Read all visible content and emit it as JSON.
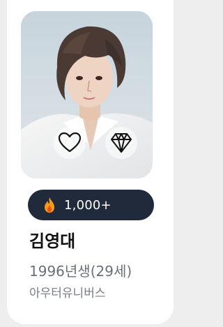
{
  "profile": {
    "name": "김영대",
    "birth": "1996년생(29세)",
    "agency": "아우터유니버스"
  },
  "stats": {
    "count_label": "1,000+",
    "icon": "fire-icon"
  },
  "actions": {
    "like_icon": "heart-icon",
    "gem_icon": "diamond-icon"
  },
  "colors": {
    "pill_bg": "#212a3b",
    "fire": "#f59a1b"
  }
}
